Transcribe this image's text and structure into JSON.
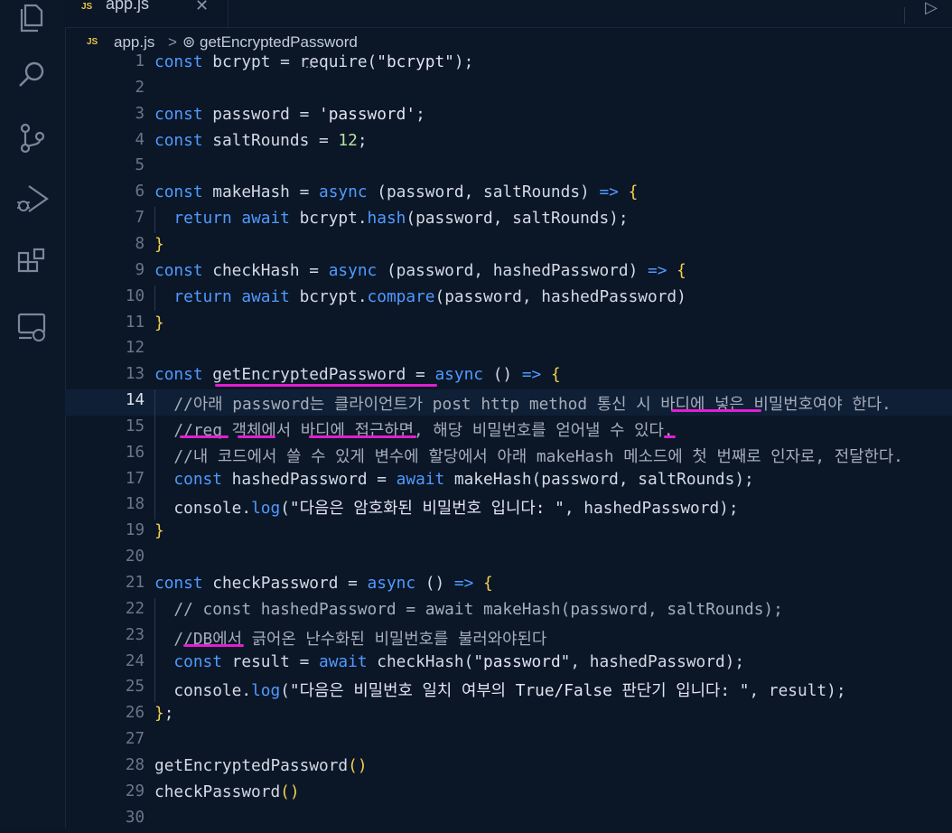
{
  "tab": {
    "badge": "JS",
    "label": "app.js",
    "close": "✕"
  },
  "breadcrumb": {
    "badge": "JS",
    "file": "app.js",
    "sep": ">",
    "symbol_icon": "⊚",
    "symbol": "getEncryptedPassword"
  },
  "activity_bar": [
    "files-icon",
    "search-icon",
    "source-control-icon",
    "run-debug-icon",
    "extensions-icon",
    "remote-explorer-icon"
  ],
  "colors": {
    "background": "#0b1627",
    "keyword": "#4f9bff",
    "annotation": "#e01fd1",
    "bracket": "#f1d24d"
  },
  "active_line": 14,
  "lines": [
    [
      [
        "kw",
        "const"
      ],
      [
        "fn",
        " bcrypt = "
      ],
      [
        "fn",
        "require"
      ],
      [
        "paren",
        "("
      ],
      [
        "str",
        "\"bcrypt\""
      ],
      [
        "paren",
        ");"
      ]
    ],
    [],
    [
      [
        "kw",
        "const"
      ],
      [
        "fn",
        " password = "
      ],
      [
        "str",
        "'password'"
      ],
      [
        "fn",
        ";"
      ]
    ],
    [
      [
        "kw",
        "const"
      ],
      [
        "fn",
        " saltRounds = "
      ],
      [
        "num",
        "12"
      ],
      [
        "fn",
        ";"
      ]
    ],
    [],
    [
      [
        "kw",
        "const"
      ],
      [
        "fn",
        " makeHash = "
      ],
      [
        "kw",
        "async"
      ],
      [
        "fn",
        " (password, saltRounds) "
      ],
      [
        "kw",
        "=>"
      ],
      [
        "fn",
        " "
      ],
      [
        "br",
        "{"
      ]
    ],
    [
      [
        "fn",
        "  "
      ],
      [
        "kw",
        "return await"
      ],
      [
        "fn",
        " bcrypt."
      ],
      [
        "meth",
        "hash"
      ],
      [
        "fn",
        "(password, saltRounds);"
      ]
    ],
    [
      [
        "br",
        "}"
      ]
    ],
    [
      [
        "kw",
        "const"
      ],
      [
        "fn",
        " checkHash = "
      ],
      [
        "kw",
        "async"
      ],
      [
        "fn",
        " (password, hashedPassword) "
      ],
      [
        "kw",
        "=>"
      ],
      [
        "fn",
        " "
      ],
      [
        "br",
        "{"
      ]
    ],
    [
      [
        "fn",
        "  "
      ],
      [
        "kw",
        "return await"
      ],
      [
        "fn",
        " bcrypt."
      ],
      [
        "meth",
        "compare"
      ],
      [
        "fn",
        "(password, hashedPassword)"
      ]
    ],
    [
      [
        "br",
        "}"
      ]
    ],
    [],
    [
      [
        "kw",
        "const"
      ],
      [
        "fn",
        " getEncryptedPassword = "
      ],
      [
        "kw",
        "async"
      ],
      [
        "fn",
        " () "
      ],
      [
        "kw",
        "=>"
      ],
      [
        "fn",
        " "
      ],
      [
        "br",
        "{"
      ]
    ],
    [
      [
        "cm",
        "  //아래 password는 클라이언트가 post http method 통신 시 바디에 넣은 비밀번호여야 한다."
      ]
    ],
    [
      [
        "cm",
        "  //req 객체에서 바디에 접근하면, 해당 비밀번호를 얻어낼 수 있다."
      ]
    ],
    [
      [
        "cm",
        "  //내 코드에서 쓸 수 있게 변수에 할당에서 아래 makeHash 메소드에 첫 번째로 인자로, 전달한다."
      ]
    ],
    [
      [
        "fn",
        "  "
      ],
      [
        "kw",
        "const"
      ],
      [
        "fn",
        " hashedPassword = "
      ],
      [
        "kw",
        "await"
      ],
      [
        "fn",
        " makeHash(password, saltRounds);"
      ]
    ],
    [
      [
        "fn",
        "  console."
      ],
      [
        "meth",
        "log"
      ],
      [
        "fn",
        "("
      ],
      [
        "str",
        "\"다음은 암호화된 비밀번호 입니다: \""
      ],
      [
        "fn",
        ", hashedPassword);"
      ]
    ],
    [
      [
        "br",
        "}"
      ]
    ],
    [],
    [
      [
        "kw",
        "const"
      ],
      [
        "fn",
        " checkPassword = "
      ],
      [
        "kw",
        "async"
      ],
      [
        "fn",
        " () "
      ],
      [
        "kw",
        "=>"
      ],
      [
        "fn",
        " "
      ],
      [
        "br",
        "{"
      ]
    ],
    [
      [
        "cm",
        "  // const hashedPassword = await makeHash(password, saltRounds);"
      ]
    ],
    [
      [
        "cm",
        "  //DB에서 긁어온 난수화된 비밀번호를 불러와야된다"
      ]
    ],
    [
      [
        "fn",
        "  "
      ],
      [
        "kw",
        "const"
      ],
      [
        "fn",
        " result = "
      ],
      [
        "kw",
        "await"
      ],
      [
        "fn",
        " checkHash("
      ],
      [
        "str",
        "\"password\""
      ],
      [
        "fn",
        ", hashedPassword);"
      ]
    ],
    [
      [
        "fn",
        "  console."
      ],
      [
        "meth",
        "log"
      ],
      [
        "fn",
        "("
      ],
      [
        "str",
        "\"다음은 비밀번호 일치 여부의 True/False 판단기 입니다: \""
      ],
      [
        "fn",
        ", result);"
      ]
    ],
    [
      [
        "br",
        "}"
      ],
      [
        "fn",
        ";"
      ]
    ],
    [],
    [
      [
        "fn",
        "getEncryptedPassword"
      ],
      [
        "br",
        "()"
      ]
    ],
    [
      [
        "fn",
        "checkPassword"
      ],
      [
        "br",
        "()"
      ]
    ],
    []
  ]
}
